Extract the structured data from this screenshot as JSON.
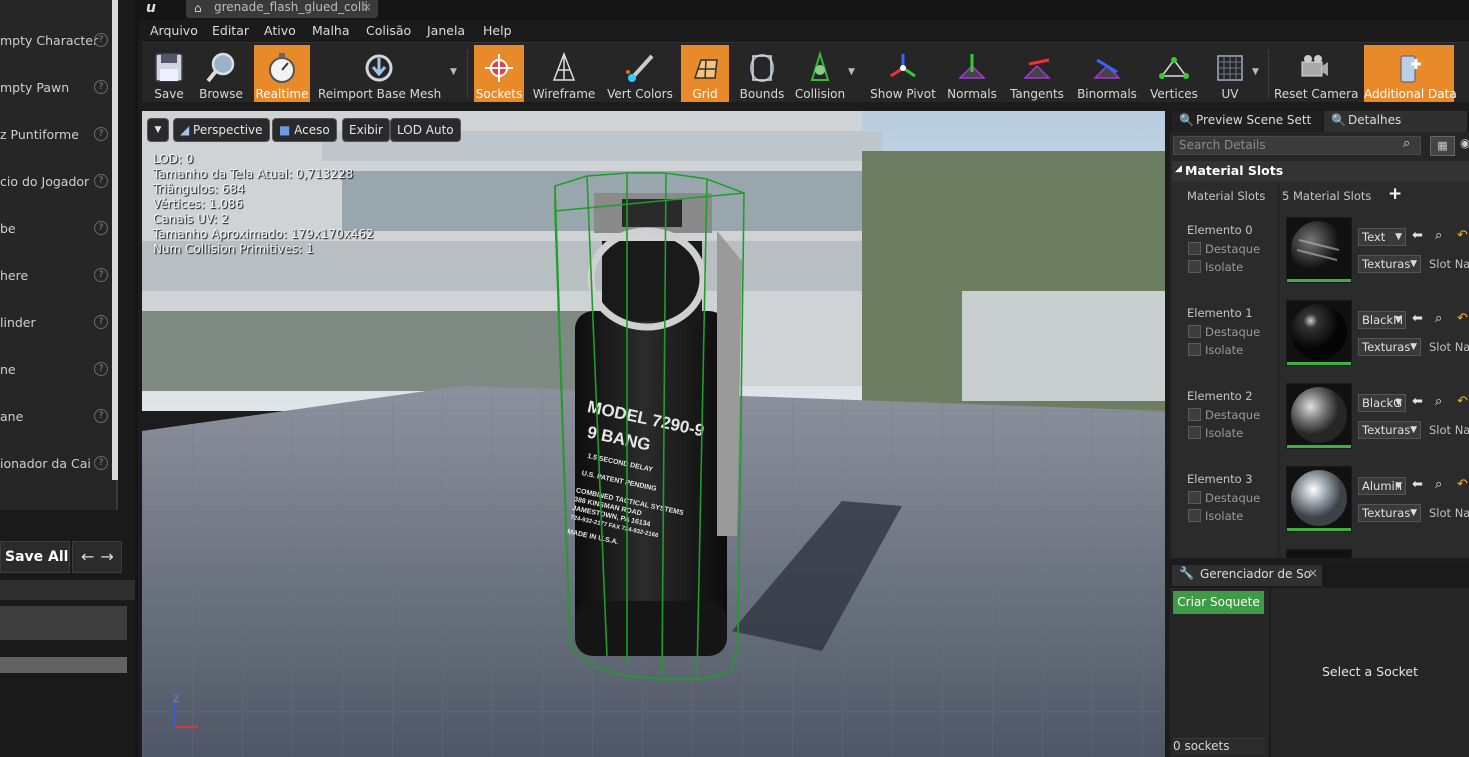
{
  "left_panel": {
    "items": [
      {
        "label": "mpty Character"
      },
      {
        "label": "mpty Pawn"
      },
      {
        "label": "z Puntiforme"
      },
      {
        "label": "cio do Jogador"
      },
      {
        "label": "be"
      },
      {
        "label": "here"
      },
      {
        "label": "linder"
      },
      {
        "label": "ne"
      },
      {
        "label": "ane"
      },
      {
        "label": "ionador da Cai"
      }
    ],
    "help_glyph": "?",
    "save_all_label": "Save All",
    "nav_arrows": "←→"
  },
  "document_tab": {
    "title": "grenade_flash_glued_colli",
    "close": "×"
  },
  "menu": [
    "Arquivo",
    "Editar",
    "Ativo",
    "Malha",
    "Colisão",
    "Janela",
    "Help"
  ],
  "toolbar": {
    "buttons": [
      {
        "label": "Save",
        "icon": "save-icon",
        "active": false
      },
      {
        "label": "Browse",
        "icon": "browse-icon",
        "active": false
      },
      {
        "label": "Realtime",
        "icon": "realtime-icon",
        "active": true
      },
      {
        "label": "Reimport Base Mesh",
        "icon": "reimport-icon",
        "active": false
      },
      {
        "label": "Sockets",
        "icon": "sockets-icon",
        "active": true
      },
      {
        "label": "Wireframe",
        "icon": "wireframe-icon",
        "active": false
      },
      {
        "label": "Vert Colors",
        "icon": "vert-colors-icon",
        "active": false
      },
      {
        "label": "Grid",
        "icon": "grid-icon",
        "active": true
      },
      {
        "label": "Bounds",
        "icon": "bounds-icon",
        "active": false
      },
      {
        "label": "Collision",
        "icon": "collision-icon",
        "active": false
      },
      {
        "label": "Show Pivot",
        "icon": "pivot-icon",
        "active": false
      },
      {
        "label": "Normals",
        "icon": "normals-icon",
        "active": false
      },
      {
        "label": "Tangents",
        "icon": "tangents-icon",
        "active": false
      },
      {
        "label": "Binormals",
        "icon": "binormals-icon",
        "active": false
      },
      {
        "label": "Vertices",
        "icon": "vertices-icon",
        "active": false
      },
      {
        "label": "UV",
        "icon": "uv-icon",
        "active": false
      },
      {
        "label": "Reset Camera",
        "icon": "camera-icon",
        "active": false
      },
      {
        "label": "Additional Data",
        "icon": "additional-data-icon",
        "active": true
      }
    ],
    "accent": "#e88a2a"
  },
  "viewport": {
    "menu_glyph": "▼",
    "perspective": "Perspective",
    "lit": "Aceso",
    "show": "Exibir",
    "lod": "LOD Auto",
    "stats": [
      "LOD: 0",
      "Tamanho da Tela Atual: 0,713228",
      "Triângulos: 684",
      "Vértices: 1.086",
      "Canais UV: 2",
      "Tamanho Aproximado: 179x170x462",
      "Num Collision Primitives:  1"
    ],
    "grenade_text": {
      "model": "MODEL 7290-9",
      "bang": "9 BANG",
      "delay": "1.5 SECOND DELAY",
      "patent": "U.S. PATENT PENDING",
      "company": "COMBINED TACTICAL SYSTEMS",
      "road": "388 KINSMAN ROAD",
      "city": "JAMESTOWN, PA 16134",
      "phone": "724-932-2177  FAX 724-932-2166",
      "made": "MADE IN U.S.A."
    },
    "axis_z": "Z",
    "collision_color": "#1f9e2a"
  },
  "details": {
    "tab_preview": "Preview Scene Sett",
    "tab_details": "Detalhes",
    "search_placeholder": "Search Details",
    "section_title": "Material Slots",
    "material_slots_label": "Material Slots",
    "material_slots_count": "5 Material Slots",
    "add_glyph": "+",
    "highlight_label": "Destaque",
    "isolate_label": "Isolate",
    "textures_label": "Texturas",
    "slot_name_label": "Slot Nar",
    "elements": [
      {
        "label": "Elemento 0",
        "material": "Text"
      },
      {
        "label": "Elemento 1",
        "material": "BlackM"
      },
      {
        "label": "Elemento 2",
        "material": "BlackG"
      },
      {
        "label": "Elemento 3",
        "material": "Alumin"
      }
    ]
  },
  "socket_manager": {
    "tab_label": "Gerenciador de So",
    "close": "×",
    "create_button": "Criar Soquete",
    "count": "0 sockets",
    "placeholder": "Select a Socket"
  }
}
